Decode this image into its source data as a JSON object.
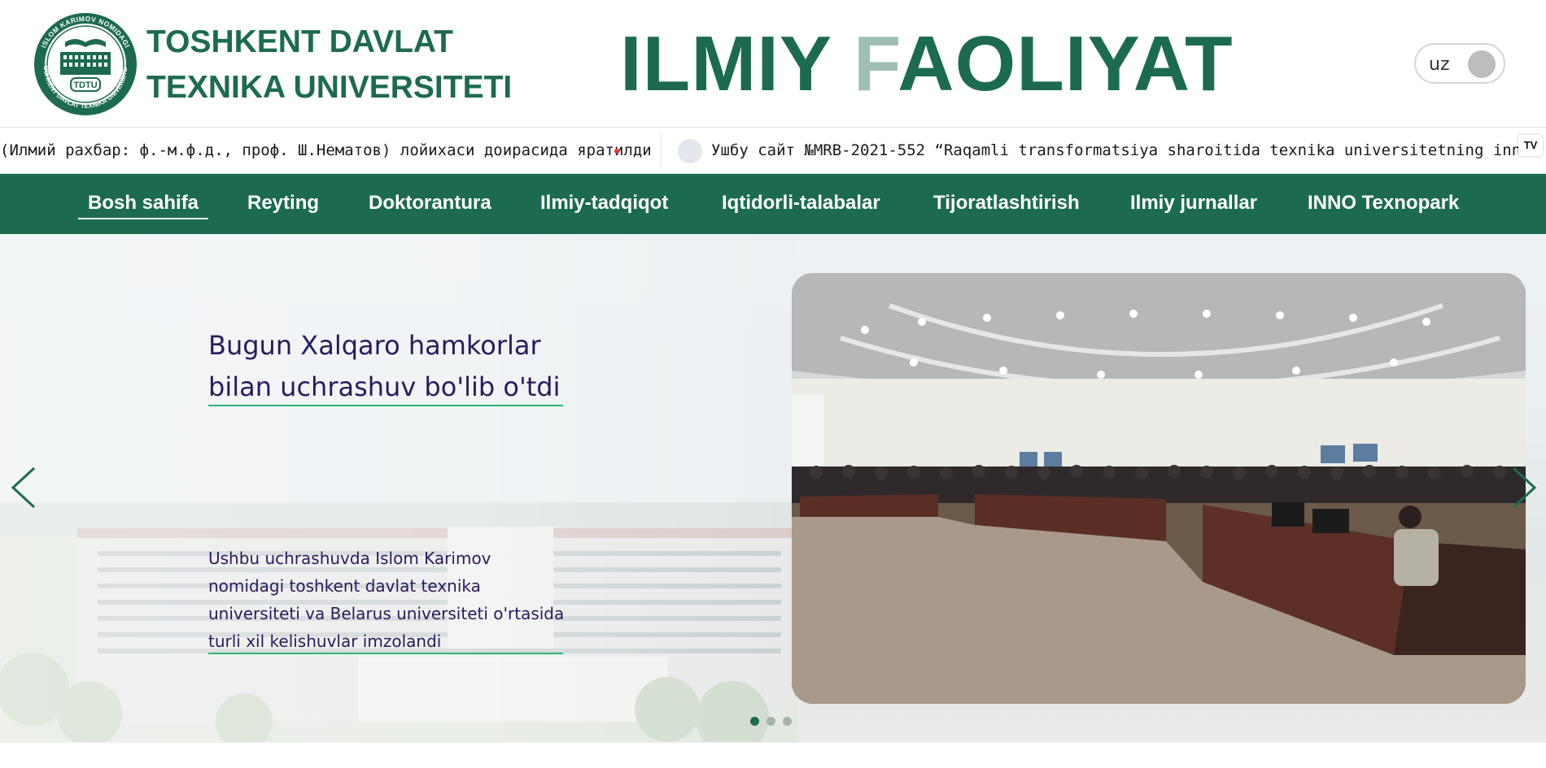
{
  "header": {
    "logo_alt": "ISLOM KARIMOV NOMIDAGI TOSHKENT DAVLAT TEXNIKA UNIVERSITETI",
    "logo_badge": "TDTU",
    "university_line1": "TOSHKENT DAVLAT",
    "university_line2": "TEXNIKA UNIVERSITETI",
    "site_title_part1": "ILMIY ",
    "site_title_part2": "F",
    "site_title_part3": "AOLIYAT",
    "language": "uz"
  },
  "ticker": {
    "text_left": "(Илмий рахбар: ф.-м.ф.д., проф. Ш.Нематов) лойихаси доирасида яратилди",
    "text_right": "Ушбу сайт №MRB-2021-552 “Raqamli transformatsiya sharoitida texnika universitetning innovatsion muhitini",
    "badge": "TV"
  },
  "nav": {
    "items": [
      {
        "label": "Bosh sahifa"
      },
      {
        "label": "Reyting"
      },
      {
        "label": "Doktorantura"
      },
      {
        "label": "Ilmiy-tadqiqot"
      },
      {
        "label": "Iqtidorli-talabalar"
      },
      {
        "label": "Tijoratlashtirish"
      },
      {
        "label": "Ilmiy jurnallar"
      },
      {
        "label": "INNO Texnopark"
      }
    ],
    "active_index": 0
  },
  "slider": {
    "title": "Bugun Xalqaro hamkorlar bilan uchrashuv bo'lib o'tdi",
    "description": "Ushbu uchrashuvda Islom Karimov nomidagi toshkent davlat texnika universiteti va Belarus universiteti o'rtasida turli xil kelishuvlar imzolandi",
    "slide_count": 3,
    "active_slide": 1
  },
  "colors": {
    "brand_green": "#1d6b4f",
    "title_purple": "#2a1a5e",
    "accent_green_line": "#2bb673"
  }
}
